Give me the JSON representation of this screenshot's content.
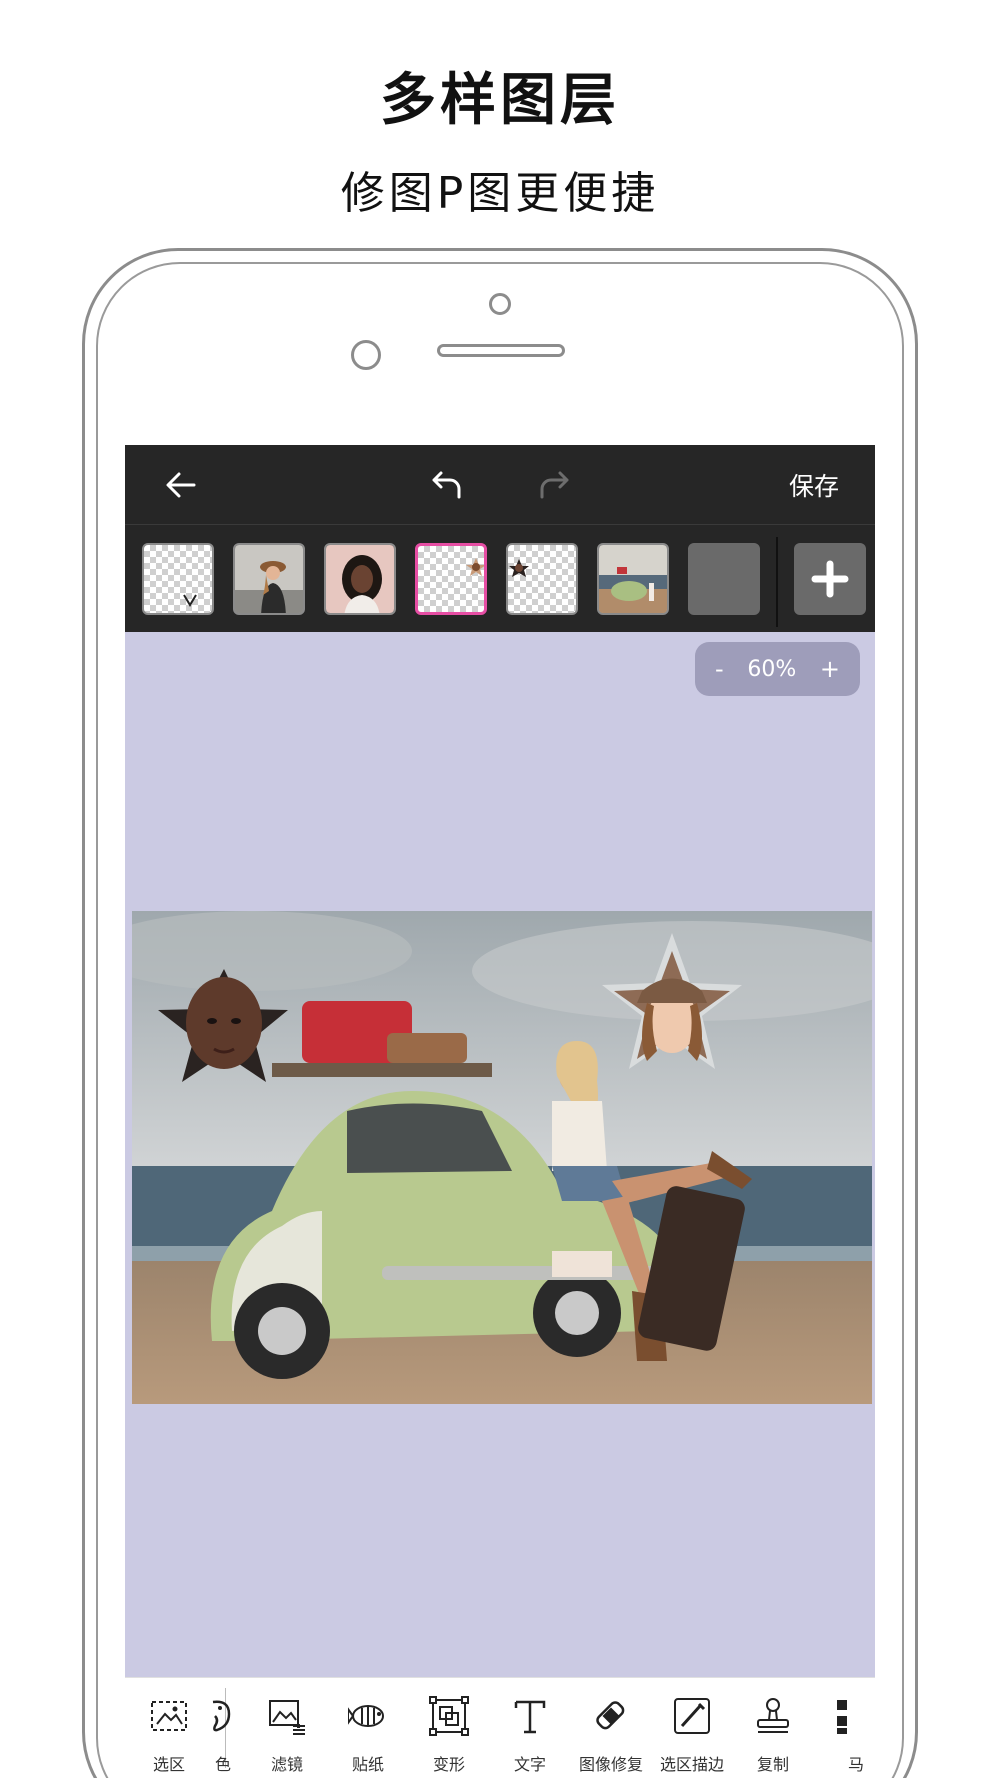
{
  "headline": {
    "title": "多样图层",
    "subtitle": "修图P图更便捷"
  },
  "header": {
    "save_label": "保存",
    "icons": [
      "back-arrow-icon",
      "undo-icon",
      "redo-icon"
    ]
  },
  "layers": {
    "items": [
      {
        "name": "transparent-layer"
      },
      {
        "name": "woman-hat-photo-layer"
      },
      {
        "name": "woman-portrait-layer"
      },
      {
        "name": "star-face-layer",
        "selected": true
      },
      {
        "name": "small-face-layer"
      },
      {
        "name": "car-photo-layer"
      },
      {
        "name": "blank-layer"
      }
    ],
    "add_icon": "plus-icon"
  },
  "zoom": {
    "minus": "-",
    "value": "60%",
    "plus": "+"
  },
  "tools": [
    {
      "label": "选区",
      "icon": "selection-icon"
    },
    {
      "label": "色",
      "icon": "color-icon"
    },
    {
      "label": "滤镜",
      "icon": "filter-icon"
    },
    {
      "label": "贴纸",
      "icon": "sticker-icon"
    },
    {
      "label": "变形",
      "icon": "transform-icon"
    },
    {
      "label": "文字",
      "icon": "text-icon"
    },
    {
      "label": "图像修复",
      "icon": "repair-icon"
    },
    {
      "label": "选区描边",
      "icon": "stroke-icon"
    },
    {
      "label": "复制",
      "icon": "stamp-icon"
    },
    {
      "label": "马",
      "icon": "mosaic-icon"
    }
  ],
  "colors": {
    "canvas_bg": "#cbcae3",
    "bar_bg": "#262626",
    "selected_layer": "#e64ea4"
  }
}
